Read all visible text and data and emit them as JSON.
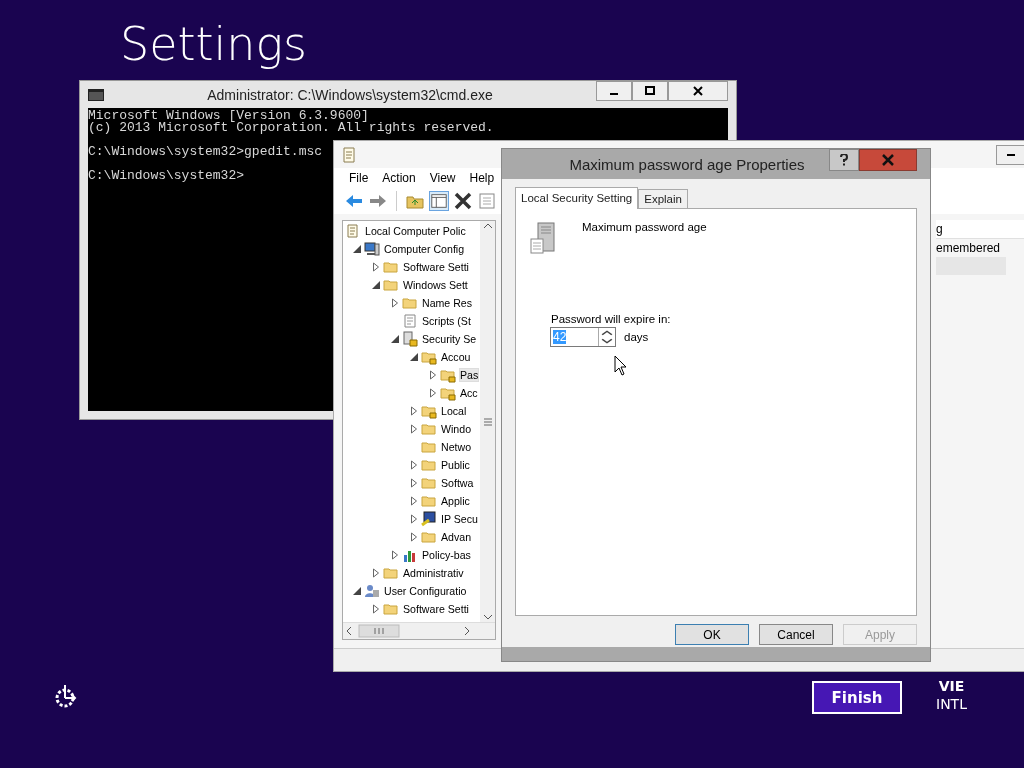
{
  "background": {
    "heading": "Settings"
  },
  "console_window": {
    "title": "Administrator: C:\\Windows\\system32\\cmd.exe",
    "blocks": [
      [
        "Microsoft Windows [Version 6.3.9600]",
        "(c) 2013 Microsoft Corporation. All rights reserved."
      ],
      [
        "C:\\Windows\\system32>gpedit.msc"
      ],
      [
        "C:\\Windows\\system32>"
      ]
    ]
  },
  "policy_editor": {
    "menu": [
      "File",
      "Action",
      "View",
      "Help"
    ],
    "tree": [
      {
        "label": "Local Computer Polic",
        "kind": "policy",
        "expandable": false,
        "selected": false,
        "children": [
          {
            "label": "Computer Config",
            "kind": "computer",
            "expandable": true,
            "expanded": true,
            "selected": false,
            "children": [
              {
                "label": "Software Setti",
                "kind": "folder",
                "expandable": true,
                "expanded": false,
                "selected": false
              },
              {
                "label": "Windows Sett",
                "kind": "folder",
                "expandable": true,
                "expanded": true,
                "selected": false,
                "children": [
                  {
                    "label": "Name Res",
                    "kind": "folder",
                    "expandable": true,
                    "expanded": false,
                    "selected": false
                  },
                  {
                    "label": "Scripts (St",
                    "kind": "script",
                    "expandable": false,
                    "selected": false
                  },
                  {
                    "label": "Security Se",
                    "kind": "security",
                    "expandable": true,
                    "expanded": true,
                    "selected": false,
                    "children": [
                      {
                        "label": "Accou",
                        "kind": "locked-folder",
                        "expandable": true,
                        "expanded": true,
                        "selected": false,
                        "children": [
                          {
                            "label": "Pas",
                            "kind": "locked-folder",
                            "expandable": true,
                            "expanded": false,
                            "selected": true
                          },
                          {
                            "label": "Acc",
                            "kind": "locked-folder",
                            "expandable": true,
                            "expanded": false,
                            "selected": false
                          }
                        ]
                      },
                      {
                        "label": "Local",
                        "kind": "locked-folder",
                        "expandable": true,
                        "expanded": false,
                        "selected": false
                      },
                      {
                        "label": "Windo",
                        "kind": "folder",
                        "expandable": true,
                        "expanded": false,
                        "selected": false
                      },
                      {
                        "label": "Netwo",
                        "kind": "folder",
                        "expandable": false,
                        "selected": false
                      },
                      {
                        "label": "Public",
                        "kind": "folder",
                        "expandable": true,
                        "expanded": false,
                        "selected": false
                      },
                      {
                        "label": "Softwa",
                        "kind": "folder",
                        "expandable": true,
                        "expanded": false,
                        "selected": false
                      },
                      {
                        "label": "Applic",
                        "kind": "folder",
                        "expandable": true,
                        "expanded": false,
                        "selected": false
                      },
                      {
                        "label": "IP Secu",
                        "kind": "ipsec",
                        "expandable": true,
                        "expanded": false,
                        "selected": false
                      },
                      {
                        "label": "Advan",
                        "kind": "folder",
                        "expandable": true,
                        "expanded": false,
                        "selected": false
                      }
                    ]
                  },
                  {
                    "label": "Policy-bas",
                    "kind": "chart",
                    "expandable": true,
                    "expanded": false,
                    "selected": false
                  }
                ]
              },
              {
                "label": "Administrativ",
                "kind": "folder",
                "expandable": true,
                "expanded": false,
                "selected": false
              }
            ]
          },
          {
            "label": "User Configuratio",
            "kind": "user",
            "expandable": true,
            "expanded": true,
            "selected": false,
            "children": [
              {
                "label": "Software Setti",
                "kind": "folder",
                "expandable": true,
                "expanded": false,
                "selected": false
              }
            ]
          }
        ]
      }
    ],
    "details": {
      "column_header": "g",
      "rows": [
        {
          "text": "emembered",
          "selected": false
        },
        {
          "selected": true
        }
      ]
    }
  },
  "dialog": {
    "title": "Maximum password age Properties",
    "tabs": [
      {
        "label": "Local Security Setting",
        "selected": true
      },
      {
        "label": "Explain",
        "selected": false
      }
    ],
    "policy_name": "Maximum password age",
    "field_label": "Password will expire in:",
    "value": "42",
    "value_highlighted": true,
    "unit": "days",
    "buttons": [
      {
        "label": "OK",
        "default": true,
        "disabled": false
      },
      {
        "label": "Cancel",
        "default": false,
        "disabled": false
      },
      {
        "label": "Apply",
        "default": false,
        "disabled": true
      }
    ]
  },
  "footer": {
    "finish": "Finish",
    "language": "VIE",
    "keyboard": "INTL"
  }
}
